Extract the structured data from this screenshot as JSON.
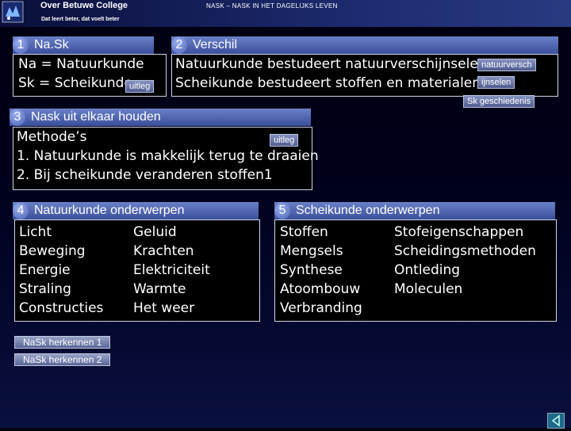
{
  "header": {
    "college": "Over Betuwe College",
    "tagline": "Dat leert beter, dat voelt beter",
    "subject": "NASK – NASK IN HET DAGELIJKS LEVEN"
  },
  "block1": {
    "number": "1",
    "title": "Na.Sk",
    "lines": [
      "Na = Natuurkunde",
      "Sk = Scheikunde"
    ],
    "button": "uitleg"
  },
  "block2": {
    "number": "2",
    "title": "Verschil",
    "lines": [
      "Natuurkunde bestudeert natuurverschijnselen",
      "Scheikunde bestudeert stoffen en materialen"
    ],
    "buttons": [
      "natuurversch",
      "ijnselen",
      "Sk geschiedenis"
    ]
  },
  "block3": {
    "number": "3",
    "title": "Nask uit elkaar houden",
    "lines": [
      "Methode’s",
      "1. Natuurkunde is makkelijk terug te draaien",
      "2. Bij scheikunde veranderen stoffen1"
    ],
    "button": "uitleg"
  },
  "block4": {
    "number": "4",
    "title": "Natuurkunde onderwerpen",
    "col1": [
      "Licht",
      "Beweging",
      "Energie",
      "Straling",
      "Constructies"
    ],
    "col2": [
      "Geluid",
      "Krachten",
      "Elektriciteit",
      "Warmte",
      "Het weer"
    ]
  },
  "block5": {
    "number": "5",
    "title": "Scheikunde onderwerpen",
    "col1": [
      "Stoffen",
      "Mengsels",
      "Synthese",
      "Atoombouw",
      "Verbranding"
    ],
    "col2": [
      "Stofeigenschappen",
      "Scheidingsmethoden",
      "Ontleding",
      "Moleculen"
    ]
  },
  "nav": {
    "buttons": [
      "NaSk herkennen 1",
      "NaSk herkennen 2"
    ],
    "back_icon": "back-arrow-icon"
  }
}
